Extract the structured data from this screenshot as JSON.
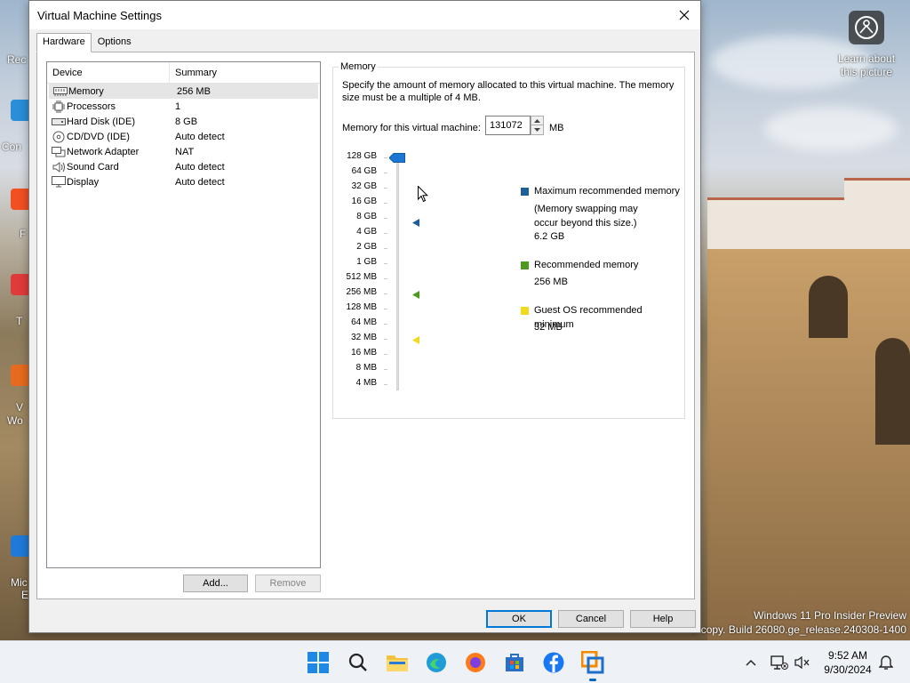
{
  "window": {
    "title": "Virtual Machine Settings",
    "tabs": [
      {
        "label": "Hardware",
        "active": true
      },
      {
        "label": "Options",
        "active": false
      }
    ]
  },
  "device_list": {
    "headers": {
      "device": "Device",
      "summary": "Summary"
    },
    "items": [
      {
        "name": "Memory",
        "summary": "256 MB",
        "icon": "memory-icon",
        "selected": true
      },
      {
        "name": "Processors",
        "summary": "1",
        "icon": "processor-icon"
      },
      {
        "name": "Hard Disk (IDE)",
        "summary": "8 GB",
        "icon": "hard-disk-icon"
      },
      {
        "name": "CD/DVD (IDE)",
        "summary": "Auto detect",
        "icon": "cd-dvd-icon"
      },
      {
        "name": "Network Adapter",
        "summary": "NAT",
        "icon": "network-adapter-icon"
      },
      {
        "name": "Sound Card",
        "summary": "Auto detect",
        "icon": "speaker-icon"
      },
      {
        "name": "Display",
        "summary": "Auto detect",
        "icon": "monitor-icon"
      }
    ],
    "add_button": "Add...",
    "remove_button": "Remove"
  },
  "memory": {
    "group_title": "Memory",
    "description": "Specify the amount of memory allocated to this virtual machine. The memory size must be a multiple of 4 MB.",
    "field_label": "Memory for this virtual machine:",
    "value": "131072",
    "unit": "MB",
    "scale_labels": [
      "128 GB",
      "64 GB",
      "32 GB",
      "16 GB",
      "8 GB",
      "4 GB",
      "2 GB",
      "1 GB",
      "512 MB",
      "256 MB",
      "128 MB",
      "64 MB",
      "32 MB",
      "16 MB",
      "8 MB",
      "4 MB"
    ],
    "slider_level": "128 GB",
    "legend": {
      "max": {
        "title": "Maximum recommended memory",
        "note": "(Memory swapping may occur beyond this size.)",
        "value": "6.2 GB",
        "color": "#1c5f99"
      },
      "recommended": {
        "title": "Recommended memory",
        "value": "256 MB",
        "color": "#4e9a1f"
      },
      "minimum": {
        "title": "Guest OS recommended minimum",
        "value": "32 MB",
        "color": "#f2d91b"
      }
    }
  },
  "buttons": {
    "ok": "OK",
    "cancel": "Cancel",
    "help": "Help"
  },
  "desktop": {
    "learn_text": "Learn about this picture",
    "watermark_line1": "Windows 11 Pro Insider Preview",
    "watermark_line2": "n copy. Build 26080.ge_release.240308-1400",
    "left_labels": [
      "Rec",
      "Con",
      "F",
      "T",
      "V",
      "Wo",
      "Mic",
      "E"
    ]
  },
  "taskbar": {
    "icons": [
      "windows-start-icon",
      "search-icon",
      "file-explorer-icon",
      "edge-icon",
      "firefox-icon",
      "store-icon",
      "facebook-icon",
      "vmware-icon"
    ],
    "time": "9:52 AM",
    "date": "9/30/2024"
  }
}
